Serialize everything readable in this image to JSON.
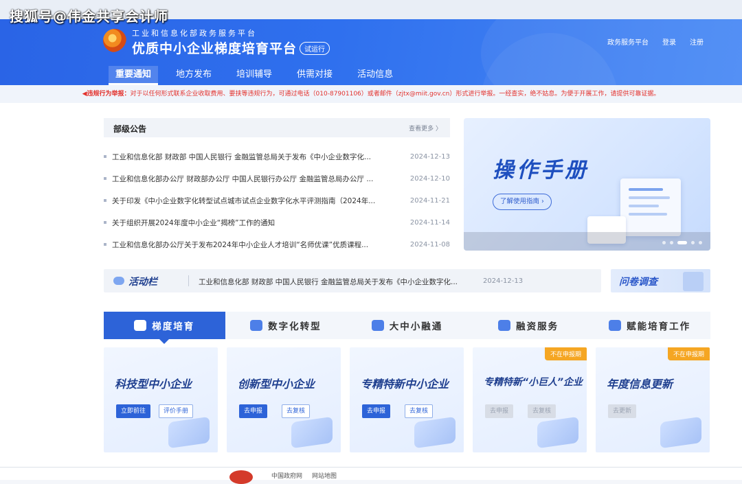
{
  "watermark": "搜狐号@伟金共享会计师",
  "header": {
    "ministry": "工业和信息化部政务服务平台",
    "title": "优质中小企业梯度培育平台",
    "badge": "试运行",
    "links": [
      "政务服务平台",
      "登录",
      "注册"
    ]
  },
  "nav": {
    "tabs": [
      "重要通知",
      "地方发布",
      "培训辅导",
      "供需对接",
      "活动信息"
    ],
    "active": 0
  },
  "alert": {
    "label": "违规行为举报：",
    "text": "对于以任何形式联系企业收取费用、要挟等违规行为，可通过电话（010-87901106）或者邮件（zjtx@miit.gov.cn）形式进行举报。一经查实，绝不姑息。为便于开展工作，请提供可靠证据。"
  },
  "notices": {
    "heading": "部级公告",
    "more": "查看更多 〉",
    "items": [
      {
        "title": "工业和信息化部 财政部 中国人民银行 金融监管总局关于发布《中小企业数字化...",
        "date": "2024-12-13"
      },
      {
        "title": "工业和信息化部办公厅 财政部办公厅 中国人民银行办公厅 金融监管总局办公厅 ...",
        "date": "2024-12-10"
      },
      {
        "title": "关于印发《中小企业数字化转型试点城市试点企业数字化水平评测指南（2024年...",
        "date": "2024-11-21"
      },
      {
        "title": "关于组织开展2024年度中小企业“揭榜”工作的通知",
        "date": "2024-11-14"
      },
      {
        "title": "工业和信息化部办公厅关于发布2024年中小企业人才培训“名师优课”优质课程...",
        "date": "2024-11-08"
      }
    ]
  },
  "banner": {
    "title": "操作手册",
    "button": "了解使用指南 ›",
    "slides": 5,
    "active_slide": 2
  },
  "activity": {
    "label": "活动栏",
    "text": "工业和信息化部 财政部 中国人民银行 金融监管总局关于发布《中小企业数字化...",
    "date": "2024-12-13"
  },
  "survey": {
    "label": "问卷调查"
  },
  "categories": {
    "items": [
      "梯度培育",
      "数字化转型",
      "大中小融通",
      "融资服务",
      "赋能培育工作"
    ],
    "active": 0
  },
  "cards": [
    {
      "title": "科技型中小企业",
      "btn1": "立即前往",
      "btn2": "评价手册",
      "flag": "",
      "disabled": false
    },
    {
      "title": "创新型中小企业",
      "btn1": "去申报",
      "btn2": "去复核",
      "flag": "",
      "disabled": false
    },
    {
      "title": "专精特新中小企业",
      "btn1": "去申报",
      "btn2": "去复核",
      "flag": "",
      "disabled": false
    },
    {
      "title": "专精特新“小巨人”企业",
      "btn1": "去申报",
      "btn2": "去复核",
      "flag": "不在申报期",
      "disabled": true
    },
    {
      "title": "年度信息更新",
      "btn1": "去更新",
      "btn2": "",
      "flag": "不在申报期",
      "disabled": true
    }
  ],
  "footer": {
    "links": [
      "中国政府网",
      "网站地图"
    ]
  }
}
